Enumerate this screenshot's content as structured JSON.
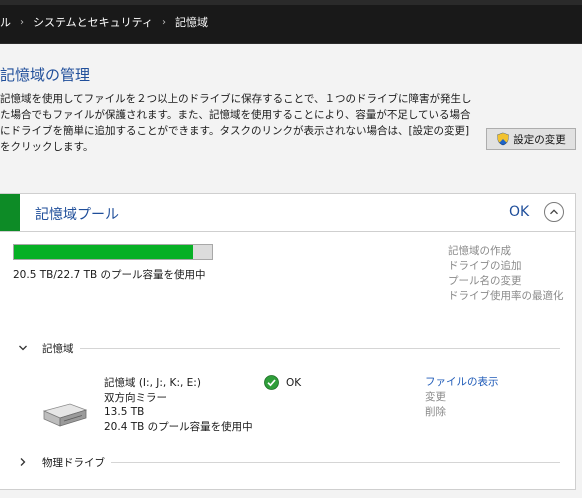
{
  "breadcrumb": {
    "items": [
      "ル",
      "システムとセキュリティ",
      "記憶域"
    ],
    "separator": "›"
  },
  "header": {
    "title": "記憶域の管理",
    "description": "記憶域を使用してファイルを２つ以上のドライブに保存することで、１つのドライブに障害が発生した場合でもファイルが保護されます。また、記憶域を使用することにより、容量が不足している場合にドライブを簡単に追加することができます。タスクのリンクが表示されない場合は、[設定の変更] をクリックします。",
    "settings_button": "設定の変更"
  },
  "pool": {
    "title": "記憶域プール",
    "status": "OK",
    "usage_fraction": 0.903,
    "usage_text": "20.5 TB/22.7 TB のプール容量を使用中",
    "tasks": [
      "記憶域の作成",
      "ドライブの追加",
      "プール名の変更",
      "ドライブ使用率の最適化"
    ],
    "sections": {
      "spaces_label": "記憶域",
      "physical_label": "物理ドライブ"
    },
    "space": {
      "name": "記憶域 (I:, J:, K:, E:)",
      "resiliency": "双方向ミラー",
      "capacity": "13.5 TB",
      "usage": "20.4 TB のプール容量を使用中",
      "status": "OK",
      "links": {
        "view_files": "ファイルの表示",
        "change": "変更",
        "delete": "削除"
      }
    }
  },
  "colors": {
    "accent_green": "#0d8b26",
    "bar_green": "#06b025",
    "link_blue": "#1f5bb8",
    "title_blue": "#1f4e9a"
  }
}
